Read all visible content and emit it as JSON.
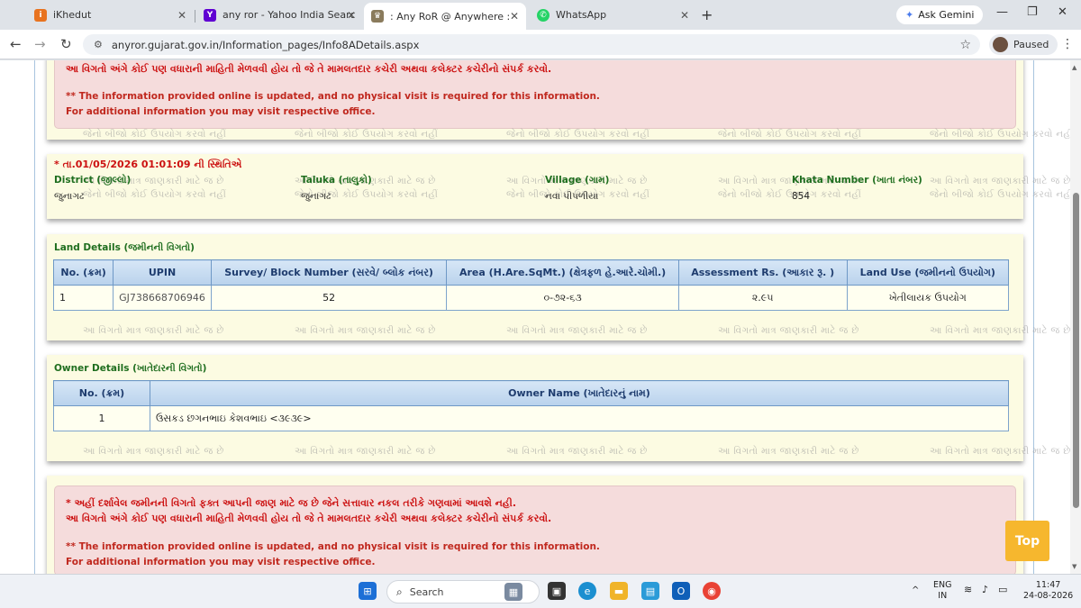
{
  "browser": {
    "tabs": [
      {
        "label": "iKhedut",
        "icon": "ikhedut-icon"
      },
      {
        "label": "any ror - Yahoo India Search Re",
        "icon": "yahoo-icon"
      },
      {
        "label": ": Any RoR @ Anywhere :",
        "icon": "emblem-icon",
        "active": true
      },
      {
        "label": "WhatsApp",
        "icon": "whatsapp-icon"
      }
    ],
    "gemini_label": "Ask Gemini",
    "url": "anyror.gujarat.gov.in/Information_pages/Info8ADetails.aspx",
    "profile_label": "Paused"
  },
  "notice_top": {
    "gu_line2": "આ વિગતો અંગે કોઈ પણ વધારાની માહિતી મેળવવી હોય તો જે તે મામલતદાર કચેરી અથવા કલેક્ટર કચેરીનો સંપર્ક કરવો.",
    "en_line1": "** The information provided online is updated, and no physical visit is required for this information.",
    "en_line2": "For additional information you may visit respective office."
  },
  "watermark": {
    "line_a": "આ વિગતો માત્ર જાણકારી માટે જ છે",
    "line_b": "જેનો બીજો કોઈ ઉપયોગ કરવો નહીં"
  },
  "status": {
    "timestamp": "* તા.01/05/2026 01:01:09 ની સ્થિતિએ",
    "district_label": "District (જીલ્લો)",
    "district_value": "જુનાગઢ",
    "taluka_label": "Taluka (તાલુકો)",
    "taluka_value": "જુનાગઢ",
    "village_label": "Village (ગામ)",
    "village_value": "નવા પીપળીયા",
    "khata_label": "Khata Number (ખાતા નંબર)",
    "khata_value": "854"
  },
  "land": {
    "title": "Land Details (જમીનની વિગતો)",
    "headers": [
      "No. (ક્રમ)",
      "UPIN",
      "Survey/ Block Number (સરવે/ બ્લોક નંબર)",
      "Area (H.Are.SqMt.) (ક્ષેત્રફળ હે.આરે.ચોમી.)",
      "Assessment Rs. (આકાર રૂ. )",
      "Land Use (જમીનનો ઉપયોગ)"
    ],
    "row": [
      "1",
      "GJ738668706946",
      "52",
      "૦-૭૨-૬૩",
      "૨.૯૫",
      "ખેતીલાયક ઉપયોગ"
    ]
  },
  "owner": {
    "title": "Owner Details (ખાતેદારની વિગતો)",
    "headers": [
      "No. (ક્રમ)",
      "Owner Name (ખાતેદારનું નામ)"
    ],
    "row": [
      "1",
      "ઉસકડ છગનભાઇ કેશવભાઇ <૩૯૩૯>"
    ]
  },
  "notice_bottom": {
    "gu_line1": "* અહીં દર્શાવેલ જમીનની વિગતો ફક્ત આપની જાણ માટે જ છે જેને સત્તાવાર નકલ તરીકે ગણવામાં આવશે નહી.",
    "gu_line2": "આ વિગતો અંગે કોઈ પણ વધારાની માહિતી મેળવવી હોય તો જે તે મામલતદાર કચેરી અથવા કલેક્ટર કચેરીનો સંપર્ક કરવો.",
    "en_line1": "** The information provided online is updated, and no physical visit is required for this information.",
    "en_line2": "For additional information you may visit respective office."
  },
  "top_button": "Top",
  "taskbar": {
    "search_placeholder": "Search",
    "lang_top": "ENG",
    "lang_bottom": "IN",
    "time": "11:47",
    "date": "24-08-2026"
  }
}
